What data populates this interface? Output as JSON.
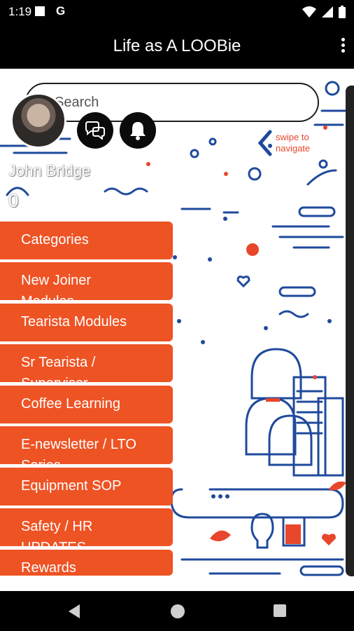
{
  "status_bar": {
    "time": "1:19",
    "carrier_letter": "G",
    "icons": [
      "stop-icon",
      "wifi-icon",
      "signal-icon",
      "battery-icon"
    ]
  },
  "app_bar": {
    "title": "Life as A LOOBie",
    "overflow_icon": "more-vert-icon"
  },
  "search": {
    "placeholder": "Search"
  },
  "profile": {
    "name": "John Bridge",
    "points": "0"
  },
  "actions": {
    "chat_icon": "chat-icon",
    "bell_icon": "bell-icon"
  },
  "swipe_hint": {
    "text": "swipe to navigate",
    "icon": "chevron-left-icon"
  },
  "menu": {
    "items": [
      {
        "label": "Categories"
      },
      {
        "label": "New Joiner\nModules"
      },
      {
        "label": "Tearista Modules"
      },
      {
        "label": "Sr Tearista /\nSupervisor"
      },
      {
        "label": "Coffee Learning"
      },
      {
        "label": "E-newsletter / LTO\nSeries"
      },
      {
        "label": "Equipment SOP"
      },
      {
        "label": "Safety / HR\nUPDATES"
      },
      {
        "label": "Rewards"
      }
    ]
  },
  "colors": {
    "accent": "#ee5324",
    "illustration_blue": "#1f4a9c",
    "illustration_orange": "#e8472c"
  }
}
